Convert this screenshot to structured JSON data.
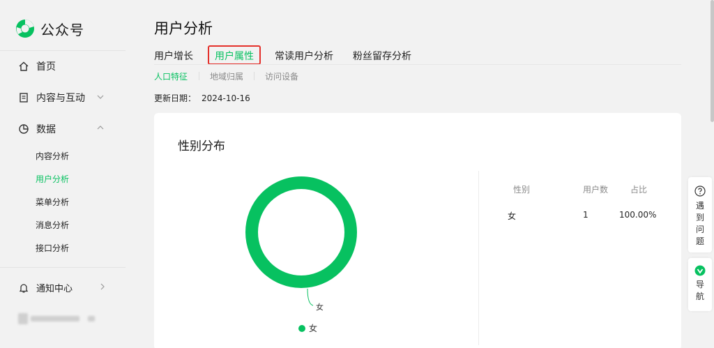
{
  "app": {
    "name": "公众号"
  },
  "sidebar": {
    "home": "首页",
    "content": "内容与互动",
    "data": "数据",
    "data_items": [
      "内容分析",
      "用户分析",
      "菜单分析",
      "消息分析",
      "接口分析"
    ],
    "active_item": "用户分析",
    "notifications": "通知中心"
  },
  "page": {
    "title": "用户分析"
  },
  "tabs": [
    "用户增长",
    "用户属性",
    "常读用户分析",
    "粉丝留存分析"
  ],
  "active_tab": "用户属性",
  "subtabs": [
    "人口特征",
    "地域归属",
    "访问设备"
  ],
  "active_subtab": "人口特征",
  "update": {
    "label": "更新日期：",
    "date": "2024-10-16"
  },
  "card": {
    "title": "性别分布",
    "table": {
      "headers": [
        "性别",
        "用户数",
        "占比"
      ],
      "rows": [
        [
          "女",
          "1",
          "100.00%"
        ]
      ]
    }
  },
  "chart_data": {
    "type": "pie",
    "categories": [
      "女"
    ],
    "values": [
      1
    ],
    "percent": [
      100.0
    ],
    "title": "性别分布",
    "legend": "bottom",
    "colors": [
      "#07c160"
    ]
  },
  "float": {
    "help": "遇到问题",
    "nav": "导航"
  },
  "colors": {
    "accent": "#07c160",
    "highlight": "#e4302b"
  }
}
